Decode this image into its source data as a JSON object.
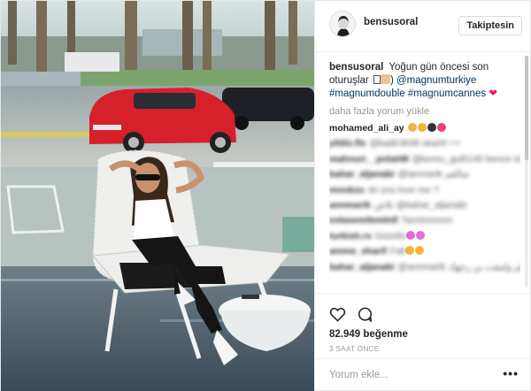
{
  "post": {
    "username": "bensusoral",
    "follow_label": "Takiptesin",
    "caption": {
      "username": "bensusoral",
      "text_1": "Yoğun gün öncesi son oturuşlar",
      "mention": "@magnumturkiye",
      "hashtag_1": "#magnumdouble",
      "hashtag_2": "#magnumcannes",
      "heart": "❤"
    },
    "load_more_label": "daha fazla yorum yükle",
    "comments": [
      {
        "user": "mohamed_ali_ay",
        "text": "",
        "clear_user": true,
        "emojis": [
          "#f3b33d",
          "#f3b33d",
          "#333333",
          "#e8436d"
        ]
      },
      {
        "user": "yildiz.flx",
        "text": "@kadir3636 skarlrt ++",
        "clear_user": false,
        "emojis": []
      },
      {
        "user": "mahnuri__polat48",
        "text": "@kereu_gul5140 bence ici onlan cok daha güzelsiniz",
        "clear_user": false,
        "emojis": []
      },
      {
        "user": "bahar_aljanabi",
        "text": "@ianmarik شالقم",
        "clear_user": false,
        "emojis": []
      },
      {
        "user": "mnnkss",
        "text": "do you love me ?",
        "clear_user": false,
        "emojis": []
      },
      {
        "user": "annmarik",
        "text": "نلاش @bahar_aljanabi",
        "clear_user": false,
        "emojis": []
      },
      {
        "user": "evlasemilemlnll",
        "text": "Tanrimmmm",
        "clear_user": false,
        "emojis": []
      },
      {
        "user": "turkish.rs",
        "text": "Güzelin",
        "clear_user": false,
        "emojis": [
          "#e36fd3",
          "#e36fd3"
        ]
      },
      {
        "user": "amme_sharif",
        "text": "Fall",
        "clear_user": false,
        "emojis": [
          "#f3b33d",
          "#f3b33d"
        ]
      },
      {
        "user": "bahar_aljanabi",
        "text": "@annmarik لالعلم ولمفت بن رحهك",
        "clear_user": false,
        "emojis": []
      }
    ],
    "likes": "82.949 beğenme",
    "time": "3 SAAT ÖNCE",
    "add_comment_placeholder": "Yorum ekle...",
    "more_options": "•••"
  },
  "icons": {
    "like": "heart-outline-icon",
    "comment": "comment-bubble-icon",
    "more": "more-options-icon"
  },
  "colors": {
    "link": "#003569",
    "heart": "#e0245e",
    "muted": "#999999",
    "text": "#262626"
  }
}
